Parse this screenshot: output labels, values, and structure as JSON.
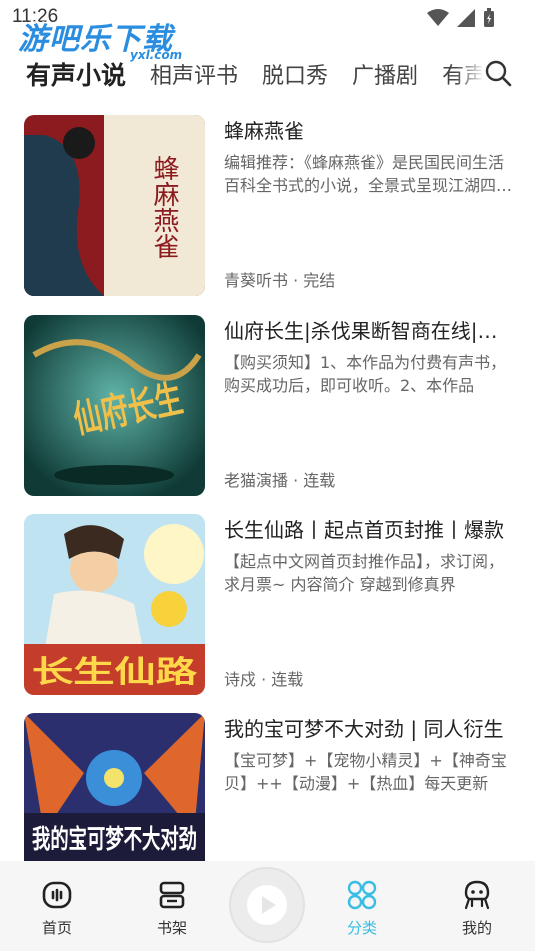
{
  "status": {
    "time": "11:26"
  },
  "watermark": {
    "main": "游吧乐下载",
    "sub": "yxl.com"
  },
  "tabs": [
    "有声小说",
    "相声评书",
    "脱口秀",
    "广播剧",
    "有声书"
  ],
  "books": [
    {
      "title": "蜂麻燕雀",
      "desc": "编辑推荐：《蜂麻燕雀》是民国民间生活百科全书式的小说，全景式呈现江湖四大门派传奇",
      "meta": "青葵听书 · 完结",
      "cover_text": "蜂麻燕雀"
    },
    {
      "title": "仙府长生|杀伐果断智商在线|热血爽文",
      "desc": "【购买须知】1、本作品为付费有声书，购买成功后，即可收听。2、本作品",
      "meta": "老猫演播 · 连载",
      "cover_text": "仙府长生"
    },
    {
      "title": "长生仙路丨起点首页封推丨爆款",
      "desc": "【起点中文网首页封推作品】，求订阅，求月票~ 内容简介 穿越到修真界",
      "meta": "诗戍 · 连载",
      "cover_text": "长生仙路"
    },
    {
      "title": "我的宝可梦不大对劲 | 同人衍生",
      "desc": "【宝可梦】+【宠物小精灵】+【神奇宝贝】++【动漫】+【热血】每天更新",
      "meta": "",
      "cover_text": "我的宝可梦不大对劲"
    }
  ],
  "nav": [
    {
      "label": "首页",
      "icon": "home-icon"
    },
    {
      "label": "书架",
      "icon": "bookshelf-icon"
    },
    {
      "label": "分类",
      "icon": "category-icon",
      "active": true
    },
    {
      "label": "我的",
      "icon": "profile-icon"
    }
  ],
  "colors": {
    "accent": "#39bde3",
    "watermark": "#2a8de0"
  }
}
